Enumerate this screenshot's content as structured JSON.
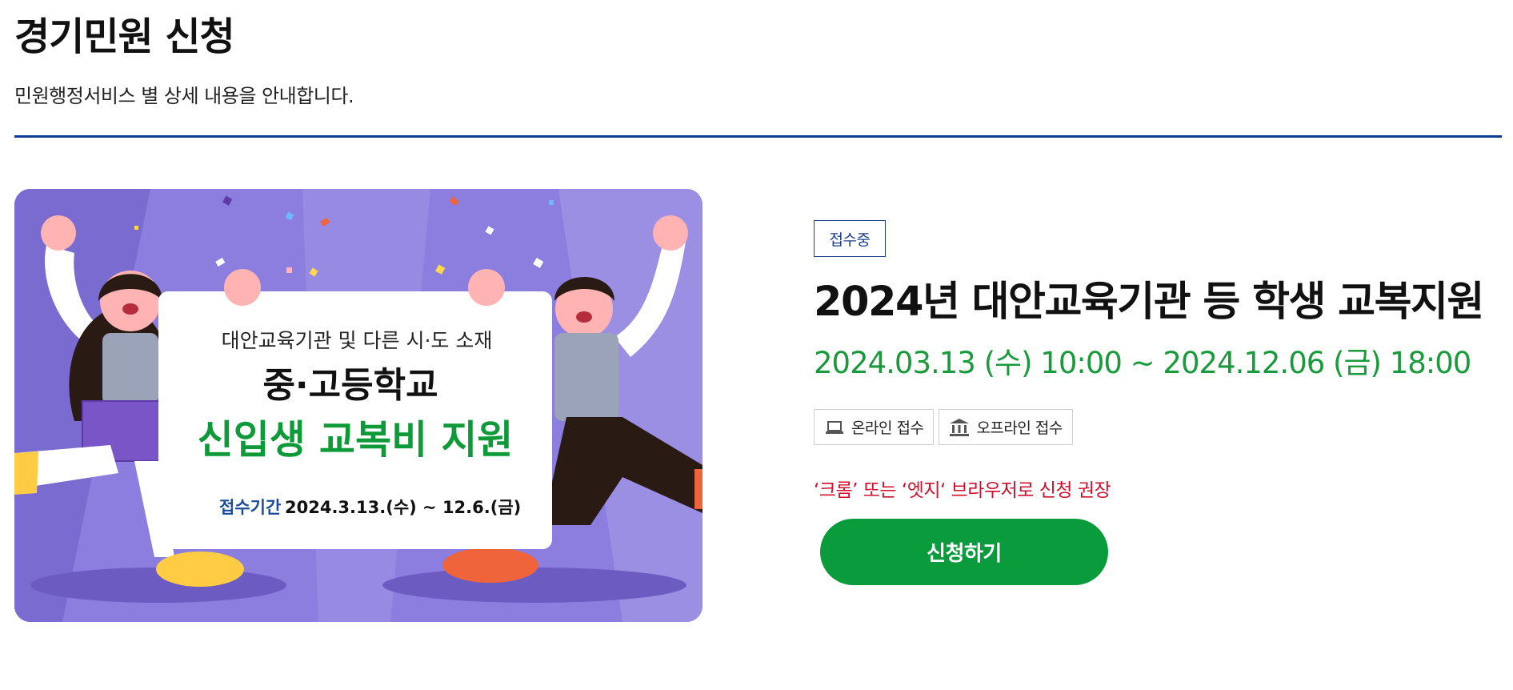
{
  "page": {
    "title": "경기민원 신청",
    "description": "민원행정서비스 별 상세 내용을 안내합니다."
  },
  "banner": {
    "subtitle": "대안교육기관 및 다른 시·도 소재",
    "headline_1": "중·고등학교",
    "headline_2": "신입생 교복비 지원",
    "period_label": "접수기간",
    "period_value": "2024.3.13.(수) ~ 12.6.(금)"
  },
  "service": {
    "status": "접수중",
    "title": "2024년 대안교육기관 등 학생 교복지원",
    "period": "2024.03.13 (수) 10:00 ~ 2024.12.06 (금) 18:00",
    "channels": [
      {
        "icon": "laptop-icon",
        "label": "온라인 접수"
      },
      {
        "icon": "building-icon",
        "label": "오프라인 접수"
      }
    ],
    "browser_notice": "‘크롬’ 또는 ‘엣지‘ 브라우저로 신청 권장",
    "apply_label": "신청하기"
  },
  "colors": {
    "accent_blue": "#0a3d91",
    "period_green": "#1a9a3c",
    "notice_red": "#d0102c",
    "button_green": "#0a9b3d",
    "banner_purple": "#8c7ede"
  }
}
